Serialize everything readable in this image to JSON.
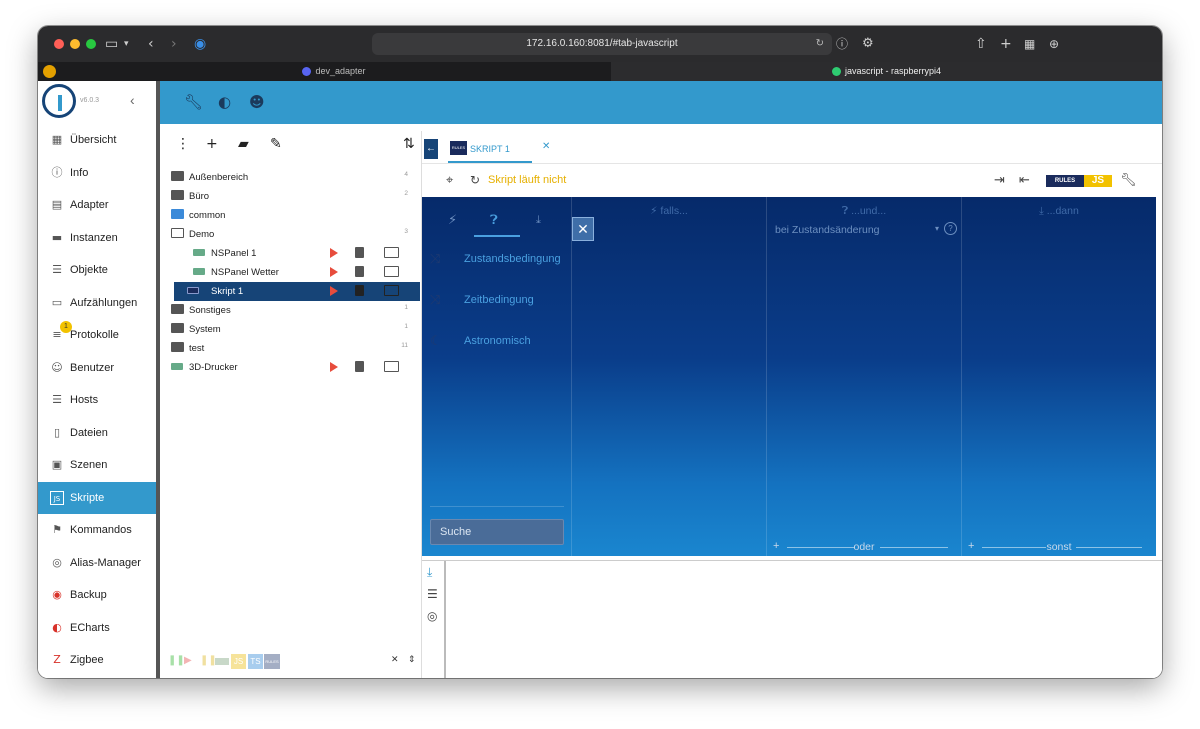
{
  "browser": {
    "url": "172.16.0.160:8081/#tab-javascript",
    "tabs": [
      "dev_adapter",
      "javascript - raspberrypi4"
    ]
  },
  "app": {
    "version": "v6.0.3",
    "nav": [
      {
        "label": "Übersicht",
        "icon": "grid-icon"
      },
      {
        "label": "Info",
        "icon": "info-icon"
      },
      {
        "label": "Adapter",
        "icon": "store-icon"
      },
      {
        "label": "Instanzen",
        "icon": "instances-icon"
      },
      {
        "label": "Objekte",
        "icon": "list-icon"
      },
      {
        "label": "Aufzählungen",
        "icon": "enum-icon"
      },
      {
        "label": "Protokolle",
        "icon": "log-icon",
        "badge": "1"
      },
      {
        "label": "Benutzer",
        "icon": "user-icon"
      },
      {
        "label": "Hosts",
        "icon": "hosts-icon"
      },
      {
        "label": "Dateien",
        "icon": "file-icon"
      },
      {
        "label": "Szenen",
        "icon": "scenes-icon"
      },
      {
        "label": "Skripte",
        "icon": "js-icon",
        "active": true
      },
      {
        "label": "Kommandos",
        "icon": "command-icon"
      },
      {
        "label": "Alias-Manager",
        "icon": "alias-icon"
      },
      {
        "label": "Backup",
        "icon": "backup-icon"
      },
      {
        "label": "ECharts",
        "icon": "echarts-icon"
      },
      {
        "label": "Zigbee",
        "icon": "zigbee-icon"
      }
    ]
  },
  "tree": {
    "rows": [
      {
        "name": "Außenbereich",
        "type": "folder",
        "count": "4"
      },
      {
        "name": "Büro",
        "type": "folder",
        "count": "2"
      },
      {
        "name": "common",
        "type": "folder-blue",
        "count": ""
      },
      {
        "name": "Demo",
        "type": "folder-open",
        "count": "3"
      },
      {
        "name": "NSPanel 1",
        "type": "script",
        "count": ""
      },
      {
        "name": "NSPanel Wetter",
        "type": "script",
        "count": ""
      },
      {
        "name": "Skript 1",
        "type": "rules",
        "count": "",
        "selected": true
      },
      {
        "name": "Sonstiges",
        "type": "folder",
        "count": "1"
      },
      {
        "name": "System",
        "type": "folder",
        "count": "1"
      },
      {
        "name": "test",
        "type": "folder",
        "count": "11"
      },
      {
        "name": "3D-Drucker",
        "type": "script-root",
        "count": ""
      }
    ],
    "footer_labels": [
      "JS",
      "TS",
      "RULES"
    ]
  },
  "editor": {
    "tab_label": "SKRIPT 1",
    "rules_mini": "RULES",
    "status": "Skript läuft nicht",
    "badge_rules": "RULES",
    "badge_js": "JS",
    "categories": [
      "Zustandsbedingung",
      "Zeitbedingung",
      "Astronomisch"
    ],
    "search_placeholder": "Suche",
    "columns": {
      "falls": "falls...",
      "und": "...und...",
      "dann": "...dann",
      "trigger": "bei Zustandsänderung",
      "oder": "oder",
      "sonst": "sonst"
    }
  },
  "colors": {
    "accent": "#3399cc",
    "dark": "#164477",
    "status": "#e6b000"
  }
}
